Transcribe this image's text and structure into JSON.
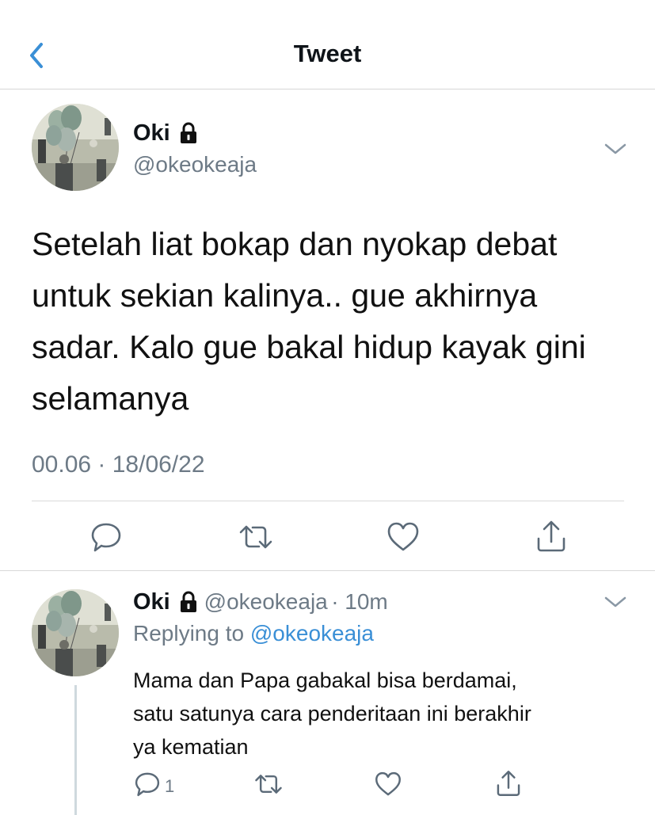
{
  "header": {
    "title": "Tweet",
    "back_icon": "chevron-left-icon"
  },
  "main_tweet": {
    "user": {
      "name": "Oki",
      "handle": "@okeokeaja",
      "protected": true
    },
    "text_lines": [
      "Setelah liat bokap dan nyokap debat",
      "untuk sekian kalinya.. gue akhirnya",
      "sadar. Kalo gue bakal hidup kayak gini",
      "selamanya"
    ],
    "timestamp": "00.06 · 18/06/22",
    "actions": [
      "reply-icon",
      "retweet-icon",
      "like-icon",
      "share-icon"
    ]
  },
  "reply_tweet": {
    "user": {
      "name": "Oki",
      "handle": "@okeokeaja",
      "protected": true
    },
    "time": "· 10m",
    "replying_to_prefix": "Replying to",
    "replying_to": "@okeokeaja",
    "text_lines": [
      "Mama dan Papa gabakal bisa berdamai,",
      "satu satunya cara penderitaan ini berakhir",
      "ya kematian"
    ],
    "reply_count": "1"
  },
  "colors": {
    "accent": "#3a8fd6",
    "muted": "#6d7a86",
    "divider": "#d9d9d9"
  }
}
